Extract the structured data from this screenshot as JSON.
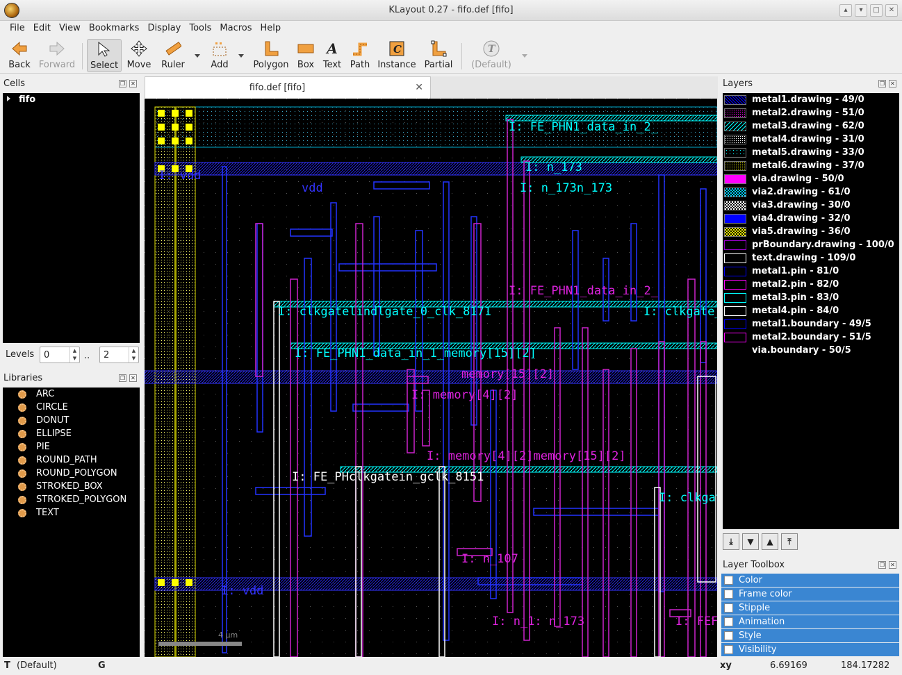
{
  "window": {
    "title": "KLayout 0.27 - fifo.def [fifo]"
  },
  "menu": [
    "File",
    "Edit",
    "View",
    "Bookmarks",
    "Display",
    "Tools",
    "Macros",
    "Help"
  ],
  "toolbar": {
    "back": "Back",
    "forward": "Forward",
    "select": "Select",
    "move": "Move",
    "ruler": "Ruler",
    "add": "Add",
    "polygon": "Polygon",
    "box": "Box",
    "text": "Text",
    "path": "Path",
    "instance": "Instance",
    "partial": "Partial",
    "default_style": "(Default)"
  },
  "cells": {
    "title": "Cells",
    "top_cell": "fifo"
  },
  "levels": {
    "label": "Levels",
    "from": "0",
    "sep": "..",
    "to": "2"
  },
  "libraries": {
    "title": "Libraries",
    "items": [
      "ARC",
      "CIRCLE",
      "DONUT",
      "ELLIPSE",
      "PIE",
      "ROUND_PATH",
      "ROUND_POLYGON",
      "STROKED_BOX",
      "STROKED_POLYGON",
      "TEXT"
    ]
  },
  "tab": {
    "label": "fifo.def [fifo]"
  },
  "canvas": {
    "scale_label": "4 µm",
    "labels": [
      "I: FE_PHN1_data_in_2_",
      "I: n_173",
      "I: n_173n_173",
      "I: vdd",
      "vdd",
      "I: FE_PHN1_data_in_2_",
      "I: clkgatelindlgate_0_clk_8171",
      "I: clkgate_",
      "I: FE_PHN1_data_in_1_memory[15][2]",
      "memory[15][2]",
      "I: memory[4][2]",
      "I: memory[4][2]memory[15][2]",
      "I: FE_PHclkgatein_gclk_8151",
      "I: clkgat",
      "I: n_107",
      "I: n_1: n_173",
      "I: FEF",
      "I: vdd"
    ]
  },
  "layers": {
    "title": "Layers",
    "items": [
      {
        "name": "metal1.drawing - 49/0",
        "color": "#0000ff",
        "fill": "hatch"
      },
      {
        "name": "metal2.drawing - 51/0",
        "color": "#ff00ff",
        "fill": "dots"
      },
      {
        "name": "metal3.drawing - 62/0",
        "color": "#00ffff",
        "fill": "diag"
      },
      {
        "name": "metal4.drawing - 31/0",
        "color": "#ffffff",
        "fill": "dots"
      },
      {
        "name": "metal5.drawing - 33/0",
        "color": "#00ffff",
        "fill": "sparse"
      },
      {
        "name": "metal6.drawing - 37/0",
        "color": "#ffff00",
        "fill": "dots"
      },
      {
        "name": "via.drawing - 50/0",
        "color": "#ff00ff",
        "fill": "solid"
      },
      {
        "name": "via2.drawing - 61/0",
        "color": "#00ccff",
        "fill": "check"
      },
      {
        "name": "via3.drawing - 30/0",
        "color": "#ffffff",
        "fill": "check"
      },
      {
        "name": "via4.drawing - 32/0",
        "color": "#0000ff",
        "fill": "solid"
      },
      {
        "name": "via5.drawing - 36/0",
        "color": "#ffff00",
        "fill": "check"
      },
      {
        "name": "prBoundary.drawing - 100/0",
        "color": "#9900cc",
        "fill": "none"
      },
      {
        "name": "text.drawing - 109/0",
        "color": "#ffffff",
        "fill": "none"
      },
      {
        "name": "metal1.pin - 81/0",
        "color": "#0000ff",
        "fill": "none"
      },
      {
        "name": "metal2.pin - 82/0",
        "color": "#ff00ff",
        "fill": "none"
      },
      {
        "name": "metal3.pin - 83/0",
        "color": "#00ffff",
        "fill": "none"
      },
      {
        "name": "metal4.pin - 84/0",
        "color": "#ffffff",
        "fill": "none"
      },
      {
        "name": "metal1.boundary - 49/5",
        "color": "#0000ff",
        "fill": "none"
      },
      {
        "name": "metal2.boundary - 51/5",
        "color": "#ff00ff",
        "fill": "none"
      },
      {
        "name": "via.boundary - 50/5",
        "color": "#000000",
        "fill": "none"
      }
    ]
  },
  "layer_toolbox": {
    "title": "Layer Toolbox",
    "items": [
      "Color",
      "Frame color",
      "Stipple",
      "Animation",
      "Style",
      "Visibility"
    ]
  },
  "status": {
    "mode": "T",
    "mode_value": "(Default)",
    "g": "G",
    "xy_label": "xy",
    "x": "6.69169",
    "y": "184.17282"
  }
}
